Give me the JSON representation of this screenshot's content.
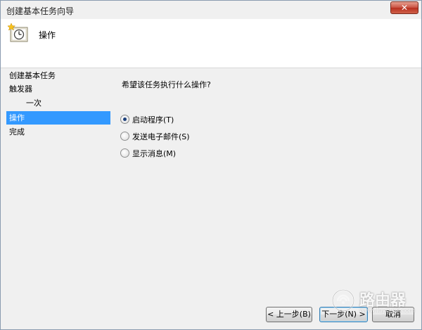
{
  "window": {
    "title": "创建基本任务向导",
    "close_glyph": "✕"
  },
  "header": {
    "title": "操作",
    "icon": "task-clock-icon"
  },
  "nav": {
    "items": [
      {
        "label": "创建基本任务",
        "active": false
      },
      {
        "label": "触发器",
        "active": false
      },
      {
        "label": "一次",
        "active": false
      },
      {
        "label": "操作",
        "active": true
      },
      {
        "label": "完成",
        "active": false
      }
    ]
  },
  "main": {
    "question": "希望该任务执行什么操作?",
    "options": [
      {
        "label": "启动程序(T)",
        "selected": true
      },
      {
        "label": "发送电子邮件(S)",
        "selected": false
      },
      {
        "label": "显示消息(M)",
        "selected": false
      }
    ]
  },
  "buttons": {
    "back": "< 上一步(B)",
    "next": "下一步(N) >",
    "cancel": "取消"
  },
  "watermark": {
    "text": "路由器",
    "subtext": "www.luyouqi.com"
  },
  "colors": {
    "selection": "#3399ff",
    "header_bg": "#ffffff",
    "window_bg": "#f0f0f0"
  }
}
